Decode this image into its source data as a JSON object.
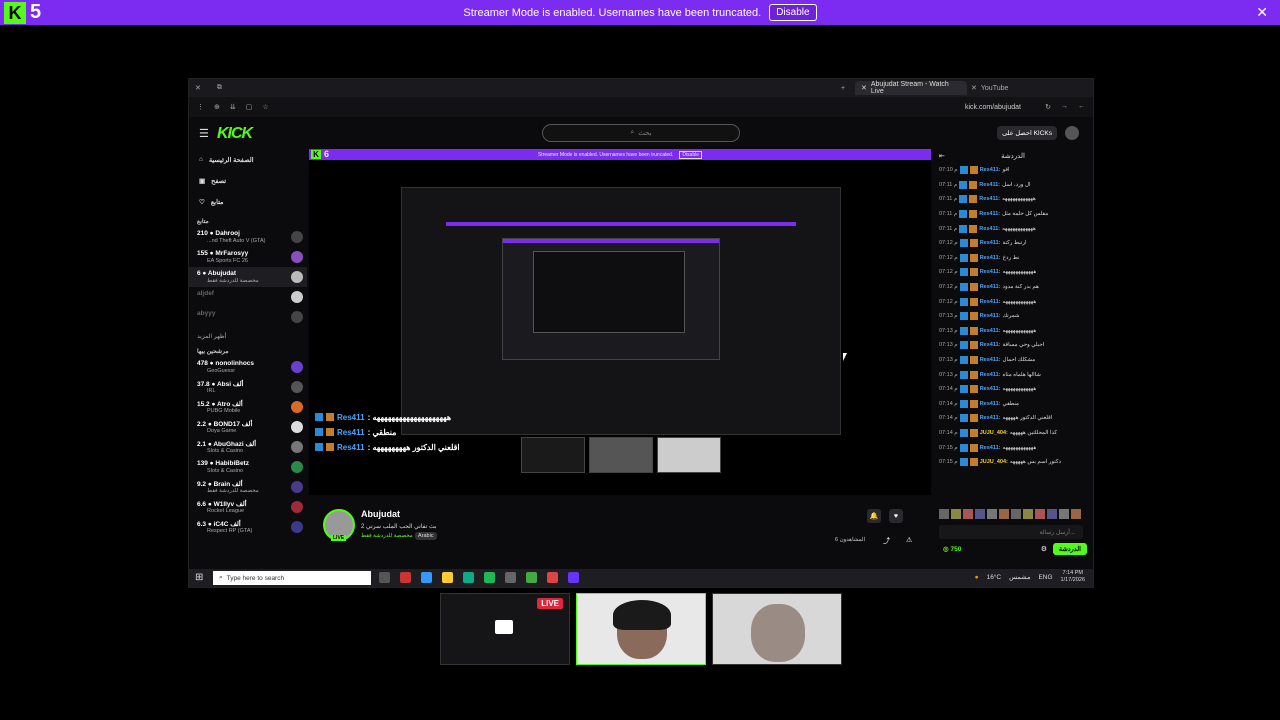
{
  "topbar": {
    "logo_letter": "K",
    "logo_number": "5",
    "message": "Streamer Mode is enabled. Usernames have been truncated.",
    "disable_label": "Disable",
    "close": "✕"
  },
  "browser": {
    "tabs": [
      {
        "label": "Abujudat Stream - Watch Live"
      },
      {
        "label": "YouTube"
      }
    ],
    "url": "kick.com/abujudat"
  },
  "kick": {
    "logo": "KICK",
    "search_placeholder": "بحث",
    "get_kicks": "احصل على KICKs",
    "nav": [
      {
        "label": "الصفحة الرئيسية",
        "icon": "home-icon"
      },
      {
        "label": "تصفح",
        "icon": "browse-icon"
      },
      {
        "label": "متابع",
        "icon": "heart-icon"
      }
    ],
    "following_title": "متابع",
    "following": [
      {
        "name": "210 ● Dahrooj",
        "sub": "...nd Theft Auto V (GTA)"
      },
      {
        "name": "155 ● MrFarosyy",
        "sub": "EA Sports FC 26"
      },
      {
        "name": "6 ● Abujudat",
        "sub": "مخصصة للدردشة فقط"
      },
      {
        "name": "aljdef",
        "sub": ""
      },
      {
        "name": "abyyy",
        "sub": ""
      }
    ],
    "show_more": "أظهر المزيد",
    "recommended_title": "مرشحين بيها",
    "recommended": [
      {
        "name": "478 ● nonolinhocs",
        "sub": "GeoGuessr"
      },
      {
        "name": "37.8 ● Absi ألف",
        "sub": "IRL"
      },
      {
        "name": "15.2 ● Atro ألف",
        "sub": "PUBG Mobile"
      },
      {
        "name": "2.2 ● BOND17 ألف",
        "sub": "Doya Game"
      },
      {
        "name": "2.1 ● AbuGhazi ألف",
        "sub": "Slots & Casino"
      },
      {
        "name": "139 ● HabibiBetz",
        "sub": "Slots & Casino"
      },
      {
        "name": "9.2 ● Brain ألف",
        "sub": "مخصصة للدردشة فقط"
      },
      {
        "name": "6.6 ● W1llyv ألف",
        "sub": "Rocket League"
      },
      {
        "name": "6.3 ● iC4C ألف",
        "sub": "Respect RP (GTA)"
      }
    ]
  },
  "video": {
    "banner_text": "Streamer Mode is enabled. Usernames have been truncated.",
    "banner_btn": "Disable",
    "logo_letter": "K",
    "logo_number": "6",
    "overlay_chat": [
      {
        "user": "Res411",
        "text": ": ههههههههههههههههههههه"
      },
      {
        "user": "Res411",
        "text": ": منطقي"
      },
      {
        "user": "Res411",
        "text": ": اقلعني الدكتور هههههههههه"
      }
    ]
  },
  "stream": {
    "name": "Abujudat",
    "live": "LIVE",
    "title": "بث تفاتي الحب الملب سرتي 2",
    "category": "مخصصة للدردشة فقط",
    "language": "Arabic",
    "viewers": "المشاهدون 6"
  },
  "chat": {
    "header": "الدردشة",
    "messages": [
      {
        "time": "07:10 م",
        "user": "Res411:",
        "text": "اقو"
      },
      {
        "time": "07:11 م",
        "user": "Res411:",
        "text": "ال ورد، اسل"
      },
      {
        "time": "07:11 م",
        "user": "Res411:",
        "text": "ههههههههههههه"
      },
      {
        "time": "07:11 م",
        "user": "Res411:",
        "text": "مقلس كل خلمة مثل"
      },
      {
        "time": "07:11 م",
        "user": "Res411:",
        "text": "ههههههههههههه"
      },
      {
        "time": "07:12 م",
        "user": "Res411:",
        "text": "ارتبط ركنة"
      },
      {
        "time": "07:12 م",
        "user": "Res411:",
        "text": "نط ردخ"
      },
      {
        "time": "07:12 م",
        "user": "Res411:",
        "text": "ههههههههههههه"
      },
      {
        "time": "07:12 م",
        "user": "Res411:",
        "text": "هم بدر كنة مدود"
      },
      {
        "time": "07:12 م",
        "user": "Res411:",
        "text": "ههههههههههههه"
      },
      {
        "time": "07:13 م",
        "user": "Res411:",
        "text": "شمرتك"
      },
      {
        "time": "07:13 م",
        "user": "Res411:",
        "text": "ههههههههههههه"
      },
      {
        "time": "07:13 م",
        "user": "Res411:",
        "text": "احبلي وحي مساقة"
      },
      {
        "time": "07:13 م",
        "user": "Res411:",
        "text": "مشكلك احمال"
      },
      {
        "time": "07:13 م",
        "user": "Res411:",
        "text": "شاالها هلماه مثاه"
      },
      {
        "time": "07:14 م",
        "user": "Res411:",
        "text": "ههههههههههههه"
      },
      {
        "time": "07:14 م",
        "user": "Res411:",
        "text": "منطقي"
      },
      {
        "time": "07:14 م",
        "user": "Res411:",
        "text": "اقلعني الدكتور هههههه"
      },
      {
        "time": "07:14 م",
        "user": "JUJU_404:",
        "text": "كذا المحللتين هههههه"
      },
      {
        "time": "07:15 م",
        "user": "Res411:",
        "text": "ههههههههههههه"
      },
      {
        "time": "07:15 م",
        "user": "JUJU_404:",
        "text": "دكتور اسم بس هههههه"
      }
    ],
    "input_placeholder": "أرسل رسالة...",
    "points": "750",
    "send_label": "الدردشة"
  },
  "taskbar": {
    "search_placeholder": "Type here to search",
    "weather": "16°C",
    "weather_desc": "مشمس",
    "lang": "ENG",
    "time": "7:14 PM",
    "date": "1/17/2026"
  },
  "bottom": {
    "live_badge": "LIVE"
  },
  "colors": {
    "kick_green": "#53fc18",
    "banner_purple": "#7b2cf0",
    "chat_user": "#4aa3ff",
    "live_red": "#e0263a"
  }
}
